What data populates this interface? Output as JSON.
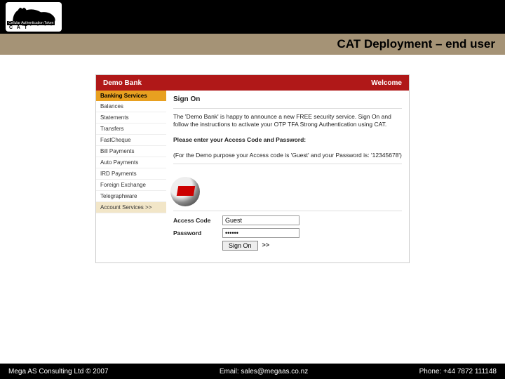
{
  "slide": {
    "title": "CAT Deployment – end user",
    "logo_alt": "CAT Cellular Authentication Token"
  },
  "bank": {
    "name": "Demo Bank",
    "welcome": "Welcome"
  },
  "sidebar": {
    "header": "Banking Services",
    "items": [
      "Balances",
      "Statements",
      "Transfers",
      "FastCheque",
      "Bill Payments",
      "Auto Payments",
      "IRD Payments",
      "Foreign Exchange",
      "Telegraphware",
      "Account Services >>"
    ]
  },
  "main": {
    "heading": "Sign On",
    "intro": "The 'Demo Bank' is happy to announce a new FREE security service. Sign On and follow the instructions to activate your OTP TFA Strong Authentication using CAT.",
    "prompt": "Please enter your Access Code and Password:",
    "hint": "(For the Demo purpose your Access code is 'Guest' and your Password is: '12345678')"
  },
  "form": {
    "access_label": "Access Code",
    "access_value": "Guest",
    "password_label": "Password",
    "password_value": "••••••",
    "button": "Sign On",
    "arrows": ">>"
  },
  "footer": {
    "left": "Mega AS Consulting Ltd © 2007",
    "email": "Email: sales@megaas.co.nz",
    "phone": "Phone: +44 7872 111148"
  }
}
